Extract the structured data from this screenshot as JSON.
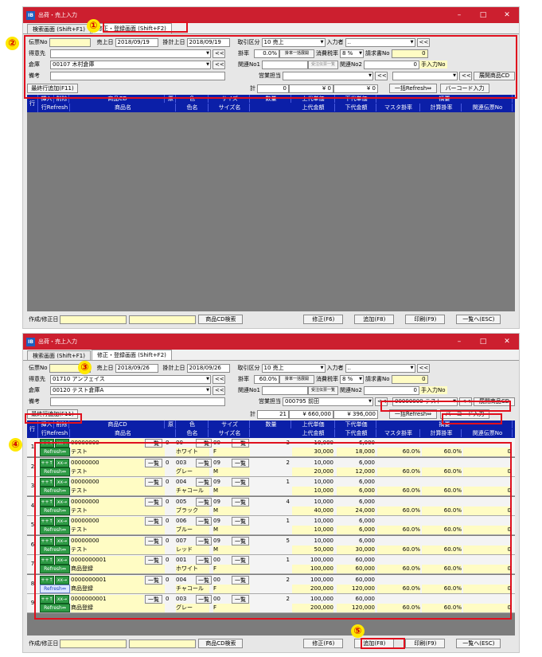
{
  "app_title": "出荷・売上入力",
  "tabs": [
    "検索画面 (Shift+F1)",
    "修正・登録画面 (Shift+F2)"
  ],
  "labels": {
    "denpyo": "伝票No",
    "uriagebi": "売上日",
    "kakeuebi": "掛計上日",
    "torihiki": "取引区分",
    "nyuryokusha": "入力者",
    "tokuisaki": "得意先",
    "kakeritsu": "掛率",
    "shohizei": "消費税率",
    "seikyusho": "請求書No",
    "soko": "倉庫",
    "kanren1": "関連No1",
    "kanren2": "関連No2",
    "tenyuryoku": "手入力No",
    "biko": "備考",
    "eigyo": "営業担当",
    "kei": "計",
    "saishu": "最終行追加(F11)",
    "ikkatsu": "一括Refresh⇔",
    "barcode": "バーコード入力",
    "tenkai": "展開商品CD",
    "ikkatsu_kakeritsu": "掛率一括展開",
    "juchu": "受注伝票一覧",
    "sakusei": "作成/修正日",
    "shohinsearch": "商品CD検索",
    "shusei": "修正(F6)",
    "tsuika": "追加(F8)",
    "insatsu": "印刷(F9)",
    "ichiran": "一覧へ(ESC)",
    "ltlt": "<<"
  },
  "columns_row1": [
    "行",
    "挿入",
    "削除",
    "商品CD",
    "原",
    "色",
    "サイズ",
    "数量",
    "上代単価",
    "下代単価",
    "摘要"
  ],
  "columns_row2": [
    "行Refresh",
    "商品名",
    "色名",
    "サイズ名",
    "上代金額",
    "下代金額",
    "マスタ掛率",
    "計算掛率",
    "関連伝票No"
  ],
  "win1": {
    "uriagebi": "2018/09/19",
    "kakeuebi": "2018/09/19",
    "torihiki": "10 売上",
    "nyuryokusha": "..",
    "tokuisaki": "",
    "kakeritsu": "0.0%",
    "zei": "8 %",
    "seikyu": "0",
    "soko": "00107 木村倉庫",
    "kanren2": "0",
    "eigyo": "",
    "kei_qty": "0",
    "kei_up": "¥ 0",
    "kei_low": "¥ 0"
  },
  "win2": {
    "uriagebi": "2018/09/26",
    "kakeuebi": "2018/09/26",
    "torihiki": "10 売上",
    "nyuryokusha": "..",
    "tokuisaki": "01710 アンフェイス",
    "kakeritsu": "60.0%",
    "zei": "8 %",
    "seikyu": "0",
    "soko": "00120 テスト倉庫A",
    "kanren2": "0",
    "eigyo": "000795 前田",
    "tenkai_val": "00000000 テスト",
    "kei_qty": "21",
    "kei_up": "¥ 660,000",
    "kei_low": "¥ 396,000"
  },
  "rows": [
    {
      "no": "1",
      "cd": "00000000",
      "gen": "0",
      "color": "00",
      "size": "00",
      "qty": "3",
      "up": "10,000",
      "low": "6,000",
      "name": "テスト",
      "colorname": "ホワイト",
      "sizename": "F",
      "upamt": "30,000",
      "lowamt": "18,000",
      "mk": "60.0%",
      "ck": "60.0%",
      "rel": "0"
    },
    {
      "no": "2",
      "cd": "00000000",
      "gen": "0",
      "color": "003",
      "size": "09",
      "qty": "2",
      "up": "10,000",
      "low": "6,000",
      "name": "テスト",
      "colorname": "グレー",
      "sizename": "M",
      "upamt": "20,000",
      "lowamt": "12,000",
      "mk": "60.0%",
      "ck": "60.0%",
      "rel": "0"
    },
    {
      "no": "3",
      "cd": "00000000",
      "gen": "0",
      "color": "004",
      "size": "09",
      "qty": "1",
      "up": "10,000",
      "low": "6,000",
      "name": "テスト",
      "colorname": "チャコール",
      "sizename": "M",
      "upamt": "10,000",
      "lowamt": "6,000",
      "mk": "60.0%",
      "ck": "60.0%",
      "rel": "0"
    },
    {
      "no": "4",
      "cd": "00000000",
      "gen": "0",
      "color": "005",
      "size": "09",
      "qty": "4",
      "up": "10,000",
      "low": "6,000",
      "name": "テスト",
      "colorname": "ブラック",
      "sizename": "M",
      "upamt": "40,000",
      "lowamt": "24,000",
      "mk": "60.0%",
      "ck": "60.0%",
      "rel": "0"
    },
    {
      "no": "5",
      "cd": "00000000",
      "gen": "0",
      "color": "006",
      "size": "09",
      "qty": "1",
      "up": "10,000",
      "low": "6,000",
      "name": "テスト",
      "colorname": "ブルー",
      "sizename": "M",
      "upamt": "10,000",
      "lowamt": "6,000",
      "mk": "60.0%",
      "ck": "60.0%",
      "rel": "0"
    },
    {
      "no": "6",
      "cd": "00000000",
      "gen": "0",
      "color": "007",
      "size": "09",
      "qty": "5",
      "up": "10,000",
      "low": "6,000",
      "name": "テスト",
      "colorname": "レッド",
      "sizename": "M",
      "upamt": "50,000",
      "lowamt": "30,000",
      "mk": "60.0%",
      "ck": "60.0%",
      "rel": "0"
    },
    {
      "no": "7",
      "cd": "0000000001",
      "gen": "0",
      "color": "001",
      "size": "00",
      "qty": "1",
      "up": "100,000",
      "low": "60,000",
      "name": "商品登録",
      "colorname": "ホワイト",
      "sizename": "F",
      "upamt": "100,000",
      "lowamt": "60,000",
      "mk": "60.0%",
      "ck": "60.0%",
      "rel": "0"
    },
    {
      "no": "8",
      "cd": "0000000001",
      "gen": "0",
      "color": "004",
      "size": "00",
      "qty": "2",
      "up": "100,000",
      "low": "60,000",
      "name": "商品登録",
      "colorname": "チャコール",
      "sizename": "F",
      "upamt": "200,000",
      "lowamt": "120,000",
      "mk": "60.0%",
      "ck": "60.0%",
      "rel": "0"
    },
    {
      "no": "9",
      "cd": "0000000001",
      "gen": "0",
      "color": "003",
      "size": "00",
      "qty": "2",
      "up": "100,000",
      "low": "60,000",
      "name": "商品登録",
      "colorname": "グレー",
      "sizename": "F",
      "upamt": "200,000",
      "lowamt": "120,000",
      "mk": "60.0%",
      "ck": "60.0%",
      "rel": "0"
    }
  ],
  "row_buttons": {
    "ins": "++↑",
    "del": "xx→",
    "refresh": "Refresh⇔",
    "ichiran": "一覧"
  },
  "markers": [
    "①",
    "②",
    "③",
    "④",
    "⑤"
  ],
  "title_buttons": [
    "–",
    "□",
    "✕"
  ],
  "accent": "#cc1f2f",
  "header_blue": "#0b1fa8",
  "highlight": "#e0101e"
}
